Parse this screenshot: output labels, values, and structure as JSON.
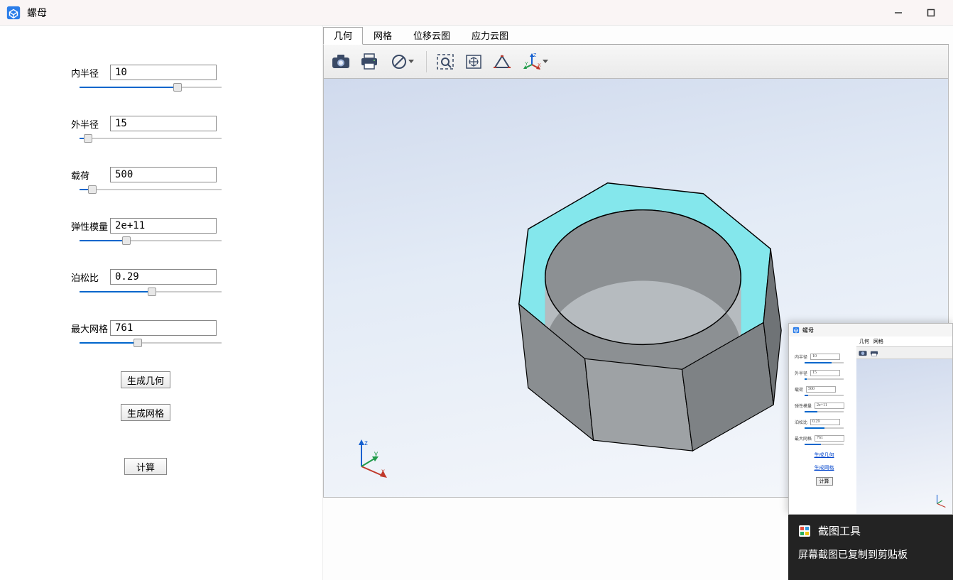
{
  "window": {
    "title": "螺母"
  },
  "params": [
    {
      "label": "内半径",
      "value": "10",
      "slider_pct": 69
    },
    {
      "label": "外半径",
      "value": "15",
      "slider_pct": 6
    },
    {
      "label": "载荷",
      "value": "500",
      "slider_pct": 9
    },
    {
      "label": "弹性模量",
      "value": "2e+11",
      "slider_pct": 33
    },
    {
      "label": "泊松比",
      "value": "0.29",
      "slider_pct": 51
    },
    {
      "label": "最大网格",
      "value": "761",
      "slider_pct": 41
    }
  ],
  "buttons": {
    "gen_geometry": "生成几何",
    "gen_mesh": "生成网格",
    "calc": "计算"
  },
  "tabs": [
    "几何",
    "网格",
    "位移云图",
    "应力云图"
  ],
  "active_tab": 0,
  "toolbar_icons": [
    "camera-icon",
    "printer-icon",
    "forbid-icon",
    "sep",
    "zoom-box-icon",
    "fit-icon",
    "measure-icon",
    "axis-icon"
  ],
  "toast": {
    "title": "截图工具",
    "message": "屏幕截图已复制到剪贴板"
  },
  "mini_tabs": [
    "几何",
    "网格"
  ],
  "mini_buttons": {
    "gen_geometry": "生成几何",
    "gen_mesh": "生成网格",
    "calc": "计算"
  }
}
